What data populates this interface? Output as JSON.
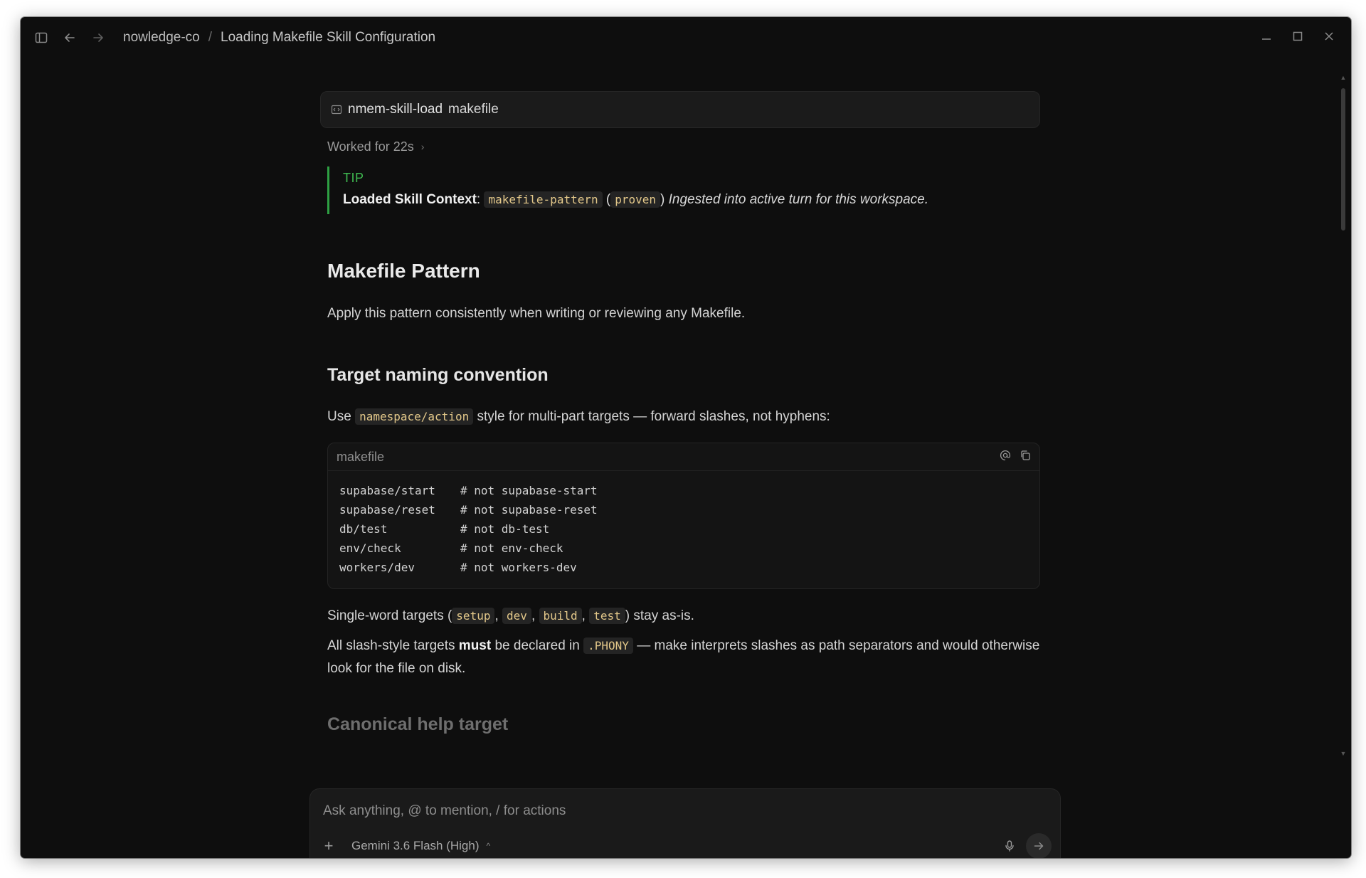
{
  "titlebar": {
    "breadcrumb": [
      "nowledge-co",
      "Loading Makefile Skill Configuration"
    ]
  },
  "command": {
    "name": "nmem-skill-load",
    "arg": "makefile"
  },
  "worked": "Worked for 22s",
  "tip": {
    "label": "TIP",
    "lead": "Loaded Skill Context",
    "skill": "makefile-pattern",
    "status": "proven",
    "note": "Ingested into active turn for this workspace."
  },
  "doc": {
    "h1": "Makefile Pattern",
    "intro": "Apply this pattern consistently when writing or reviewing any Makefile.",
    "h2": "Target naming convention",
    "use_pre": "Use",
    "use_code": "namespace/action",
    "use_post": "style for multi-part targets — forward slashes, not hyphens:",
    "codeblock": {
      "lang": "makefile",
      "lines": [
        {
          "target": "supabase/start",
          "comment": "# not supabase-start"
        },
        {
          "target": "supabase/reset",
          "comment": "# not supabase-reset"
        },
        {
          "target": "db/test",
          "comment": "# not db-test"
        },
        {
          "target": "env/check",
          "comment": "# not env-check"
        },
        {
          "target": "workers/dev",
          "comment": "# not workers-dev"
        }
      ]
    },
    "single_pre": "Single-word targets (",
    "single_codes": [
      "setup",
      "dev",
      "build",
      "test"
    ],
    "single_post": ") stay as-is.",
    "phony_pre": "All slash-style targets",
    "phony_bold": "must",
    "phony_mid": "be declared in",
    "phony_code": ".PHONY",
    "phony_post": "— make interprets slashes as path separators and would otherwise look for the file on disk.",
    "h3": "Canonical help target"
  },
  "composer": {
    "placeholder": "Ask anything, @ to mention, / for actions",
    "model": "Gemini 3.6 Flash (High)"
  }
}
